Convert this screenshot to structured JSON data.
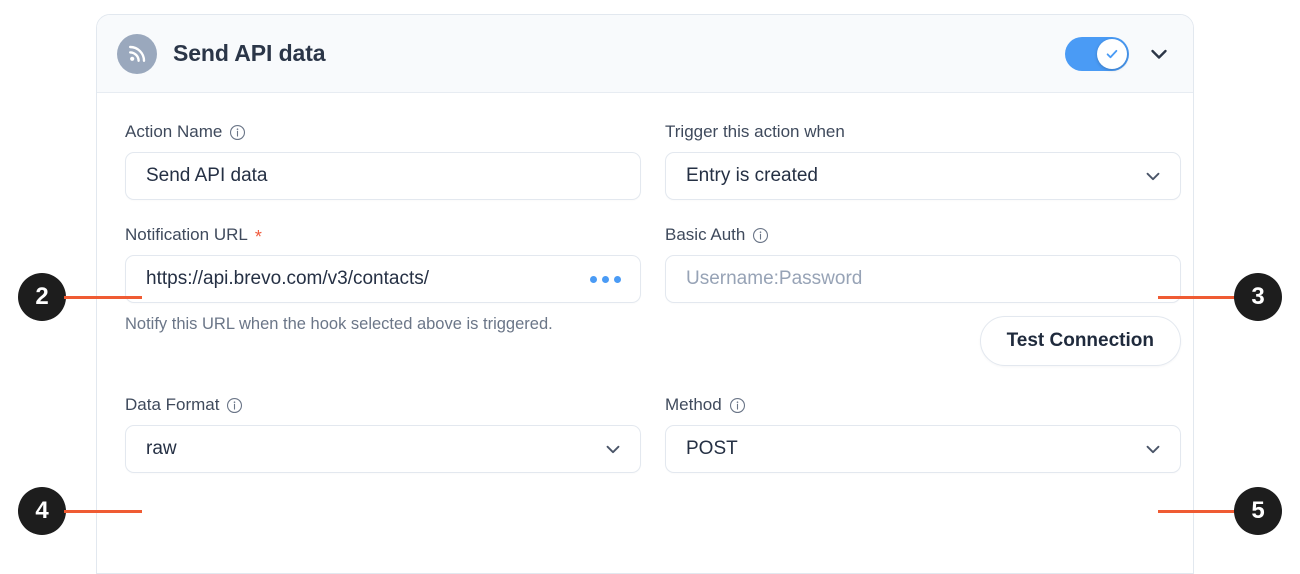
{
  "card": {
    "icon": "rss-broadcast-icon",
    "title": "Send API data",
    "enabled_toggle": {
      "state": "on",
      "icon": "check-icon",
      "color": "#4a9bf5"
    },
    "collapse_chevron_icon": "chevron-down-icon"
  },
  "fields": {
    "action_name": {
      "label": "Action Name",
      "info_icon": "info-circle-icon",
      "value": "Send API data"
    },
    "trigger_when": {
      "label": "Trigger this action when",
      "value": "Entry is created",
      "chevron_icon": "chevron-down-icon"
    },
    "notification_url": {
      "label": "Notification URL",
      "required_marker": "*",
      "value": "https://api.brevo.com/v3/contacts/",
      "more_icon": "ellipsis-icon",
      "helper": "Notify this URL when the hook selected above is triggered."
    },
    "basic_auth": {
      "label": "Basic Auth",
      "info_icon": "info-circle-icon",
      "value": "",
      "placeholder": "Username:Password"
    },
    "test_connection": {
      "label": "Test Connection"
    },
    "data_format": {
      "label": "Data Format",
      "info_icon": "info-circle-icon",
      "value": "raw",
      "chevron_icon": "chevron-down-icon"
    },
    "method": {
      "label": "Method",
      "info_icon": "info-circle-icon",
      "value": "POST",
      "chevron_icon": "chevron-down-icon"
    }
  },
  "callouts": [
    {
      "number": "2",
      "side": "left",
      "target": "notification-url-field"
    },
    {
      "number": "3",
      "side": "right",
      "target": "basic-auth-field"
    },
    {
      "number": "4",
      "side": "left",
      "target": "data-format-field"
    },
    {
      "number": "5",
      "side": "right",
      "target": "method-field"
    }
  ],
  "colors": {
    "accent_blue": "#4a9bf5",
    "callout_line": "#ef5b33",
    "required_star": "#f05a3c",
    "badge_bg": "#1d1d1d"
  }
}
